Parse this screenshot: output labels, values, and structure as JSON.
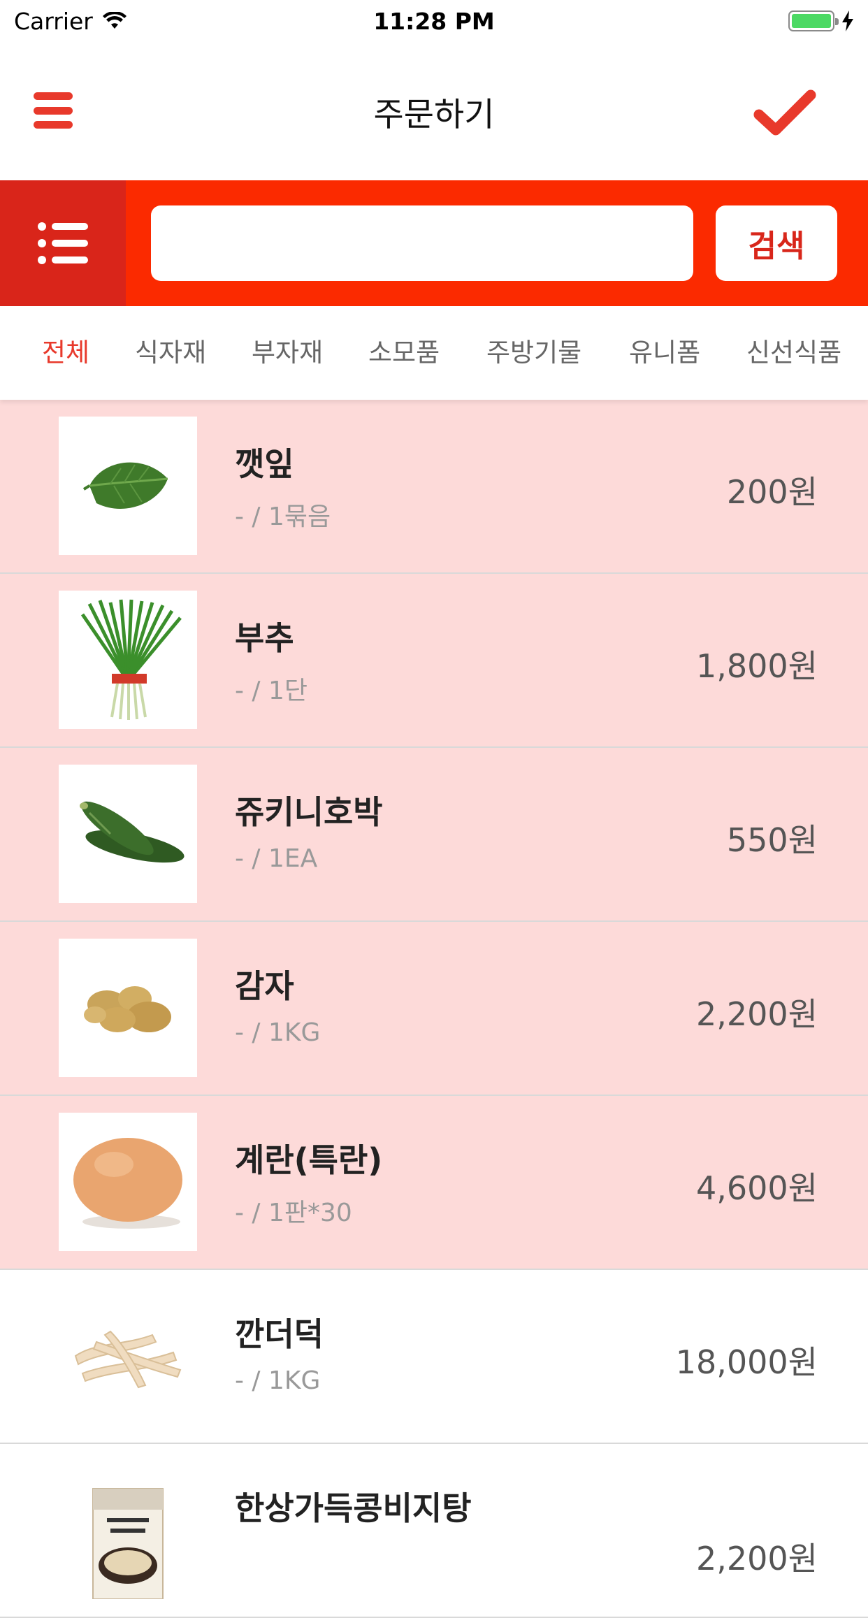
{
  "status_bar": {
    "carrier": "Carrier",
    "time": "11:28 PM"
  },
  "nav": {
    "title": "주문하기",
    "accent_color": "#e8392b"
  },
  "search": {
    "value": "",
    "placeholder": "",
    "button_label": "검색",
    "band_color": "#fb2a00"
  },
  "tabs": [
    "전체",
    "식자재",
    "부자재",
    "소모품",
    "주방기물",
    "유니폼",
    "신선식품"
  ],
  "active_tab": "전체",
  "products": [
    {
      "name": "깻잎",
      "unit": "- / 1묶음",
      "price": "200원",
      "highlight": true,
      "icon": "perilla-leaf-image"
    },
    {
      "name": "부추",
      "unit": "- / 1단",
      "price": "1,800원",
      "highlight": true,
      "icon": "chives-image"
    },
    {
      "name": "쥬키니호박",
      "unit": "- / 1EA",
      "price": "550원",
      "highlight": true,
      "icon": "zucchini-image"
    },
    {
      "name": "감자",
      "unit": "- / 1KG",
      "price": "2,200원",
      "highlight": true,
      "icon": "potato-image"
    },
    {
      "name": "계란(특란)",
      "unit": "- / 1판*30",
      "price": "4,600원",
      "highlight": true,
      "icon": "egg-image"
    },
    {
      "name": "깐더덕",
      "unit": "- / 1KG",
      "price": "18,000원",
      "highlight": false,
      "icon": "deodeok-image"
    },
    {
      "name": "한상가득콩비지탕",
      "unit": "",
      "price": "2,200원",
      "highlight": false,
      "icon": "soup-package-image"
    }
  ]
}
